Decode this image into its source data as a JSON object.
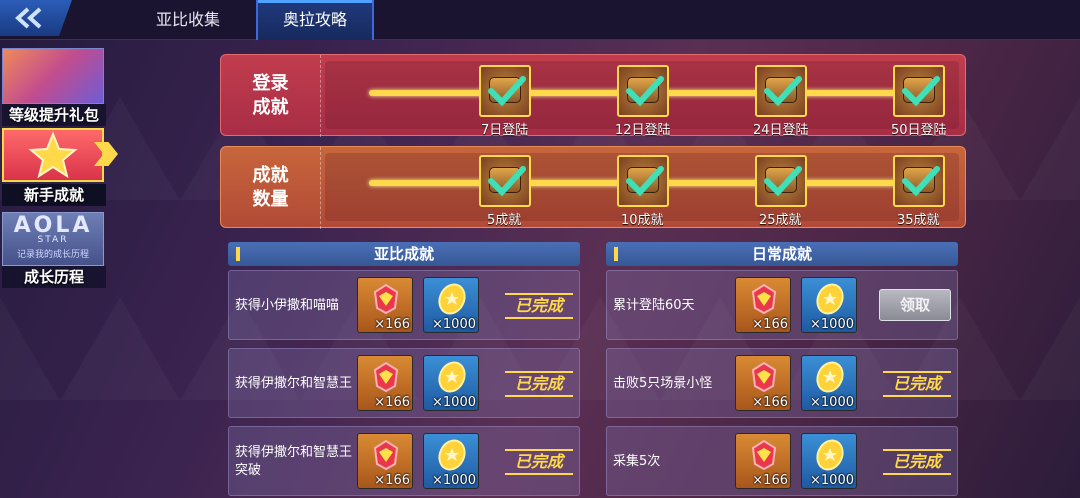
{
  "tabs": [
    {
      "label": "亚比收集",
      "active": false
    },
    {
      "label": "奥拉攻略",
      "active": true
    }
  ],
  "sidebar": {
    "items": [
      {
        "label": "等级提升礼包"
      },
      {
        "label": "新手成就",
        "active": true
      },
      {
        "label": "成长历程",
        "logo_text": "AOLA",
        "logo_sub": "STAR",
        "logo_caption": "记录我的成长历程"
      }
    ]
  },
  "login_track": {
    "title_line1": "登录",
    "title_line2": "成就",
    "nodes": [
      {
        "label": "7日登陆",
        "claimed": true
      },
      {
        "label": "12日登陆",
        "claimed": true
      },
      {
        "label": "24日登陆",
        "claimed": true
      },
      {
        "label": "50日登陆",
        "claimed": true
      }
    ]
  },
  "count_track": {
    "title_line1": "成就",
    "title_line2": "数量",
    "nodes": [
      {
        "label": "5成就",
        "claimed": true
      },
      {
        "label": "10成就",
        "claimed": true
      },
      {
        "label": "25成就",
        "claimed": true
      },
      {
        "label": "35成就",
        "claimed": true
      }
    ]
  },
  "yabi_panel": {
    "title": "亚比成就",
    "rows": [
      {
        "text": "获得小伊撒和喵喵",
        "gem_qty": "×166",
        "coin_qty": "×1000",
        "status": "已完成"
      },
      {
        "text": "获得伊撒尔和智慧王",
        "gem_qty": "×166",
        "coin_qty": "×1000",
        "status": "已完成"
      },
      {
        "text": "获得伊撒尔和智慧王突破",
        "gem_qty": "×166",
        "coin_qty": "×1000",
        "status": "已完成"
      }
    ]
  },
  "daily_panel": {
    "title": "日常成就",
    "rows": [
      {
        "text": "累计登陆60天",
        "gem_qty": "×166",
        "coin_qty": "×1000",
        "button": "领取"
      },
      {
        "text": "击败5只场景小怪",
        "gem_qty": "×166",
        "coin_qty": "×1000",
        "status": "已完成"
      },
      {
        "text": "采集5次",
        "gem_qty": "×166",
        "coin_qty": "×1000",
        "status": "已完成"
      }
    ]
  },
  "colors": {
    "accent": "#ffd94a",
    "tab_active": "#213a7e",
    "check": "#3fe0b8"
  },
  "icons": {
    "back": "double-chevron-left-icon",
    "check": "checkmark-icon",
    "gem": "red-gem-icon",
    "coin": "gold-coin-icon",
    "star": "star-icon"
  }
}
